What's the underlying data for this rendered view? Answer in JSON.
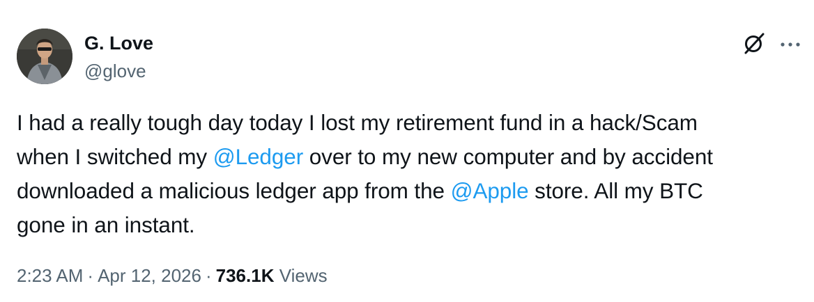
{
  "author": {
    "display_name": "G. Love",
    "handle": "@glove"
  },
  "header_icons": {
    "grok": "grok-icon",
    "more": "more-icon"
  },
  "tweet": {
    "lines": [
      [
        {
          "text": "I had a really tough day today I lost my retirement fund in a hack/Scam"
        }
      ],
      [
        {
          "text": "when I switched my "
        },
        {
          "text": "@Ledger",
          "mention": true
        },
        {
          "text": " over to my new computer and by accident"
        }
      ],
      [
        {
          "text": "downloaded a malicious ledger app from the "
        },
        {
          "text": "@Apple",
          "mention": true
        },
        {
          "text": " store. All my BTC"
        }
      ],
      [
        {
          "text": "gone in an instant."
        }
      ]
    ]
  },
  "meta": {
    "time": "2:23 AM",
    "separator": "·",
    "date": "Apr 12, 2026",
    "views_count": "736.1K",
    "views_label": "Views"
  },
  "colors": {
    "text": "#0f1419",
    "secondary": "#536471",
    "link": "#1d9bf0"
  }
}
